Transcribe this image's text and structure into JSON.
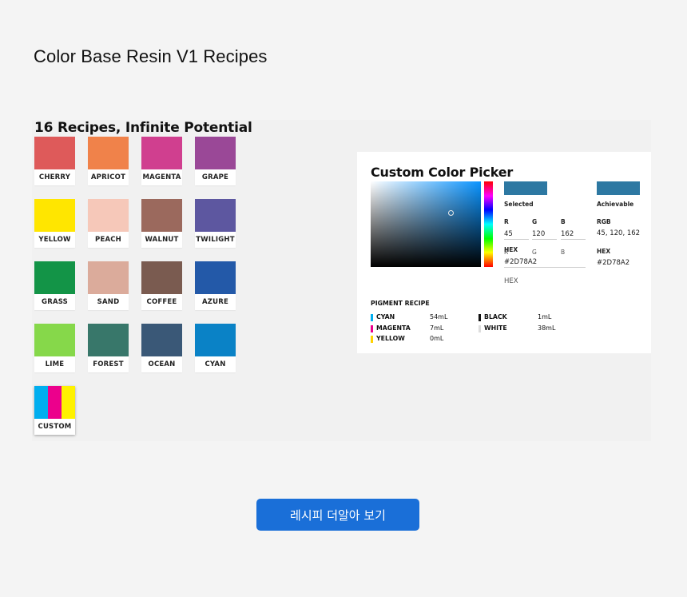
{
  "page": {
    "title": "Color Base Resin V1 Recipes"
  },
  "recipes": {
    "heading": "16 Recipes, Infinite Potential",
    "swatches": [
      {
        "name": "CHERRY",
        "color": "#de5a5a"
      },
      {
        "name": "APRICOT",
        "color": "#f0824a"
      },
      {
        "name": "MAGENTA",
        "color": "#d03f8f"
      },
      {
        "name": "GRAPE",
        "color": "#9a4897"
      },
      {
        "name": "YELLOW",
        "color": "#ffe600"
      },
      {
        "name": "PEACH",
        "color": "#f6c8b9"
      },
      {
        "name": "WALNUT",
        "color": "#9b695d"
      },
      {
        "name": "TWILIGHT",
        "color": "#5d57a0"
      },
      {
        "name": "GRASS",
        "color": "#139447"
      },
      {
        "name": "SAND",
        "color": "#dbab9b"
      },
      {
        "name": "COFFEE",
        "color": "#7a5b50"
      },
      {
        "name": "AZURE",
        "color": "#2359a8"
      },
      {
        "name": "LIME",
        "color": "#86d84a"
      },
      {
        "name": "FOREST",
        "color": "#38776a"
      },
      {
        "name": "OCEAN",
        "color": "#3a5877"
      },
      {
        "name": "CYAN",
        "color": "#0a82c6"
      }
    ],
    "custom": {
      "name": "CUSTOM",
      "stripes": [
        "#00aeef",
        "#ec008c",
        "#fff200"
      ]
    }
  },
  "picker": {
    "title": "Custom Color Picker",
    "selected_label": "Selected",
    "achievable_label": "Achievable",
    "selected_color": "#2d78a2",
    "achievable_color": "#2d78a2",
    "r_label": "R",
    "g_label": "G",
    "b_label": "B",
    "r_value": "45",
    "g_value": "120",
    "b_value": "162",
    "hex_label": "HEX",
    "hex_value": "#2D78A2",
    "hex_bottom_label": "HEX",
    "rgb_label": "RGB",
    "rgb_value": "45, 120, 162",
    "ach_hex_label": "HEX",
    "ach_hex_value": "#2D78A2"
  },
  "pigment": {
    "title": "PIGMENT RECIPE",
    "items": [
      {
        "name": "CYAN",
        "amount": "54mL",
        "color": "#00aeef"
      },
      {
        "name": "MAGENTA",
        "amount": "7mL",
        "color": "#ec008c"
      },
      {
        "name": "YELLOW",
        "amount": "0mL",
        "color": "#ffd200"
      },
      {
        "name": "BLACK",
        "amount": "1mL",
        "color": "#111111"
      },
      {
        "name": "WHITE",
        "amount": "38mL",
        "color": "#dddddd"
      }
    ]
  },
  "cta": {
    "label": "레시피 더알아 보기"
  }
}
